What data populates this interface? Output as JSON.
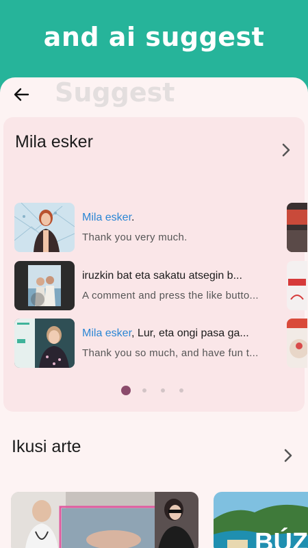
{
  "banner": {
    "title": "and ai suggest"
  },
  "header": {
    "watermark": "Suggest",
    "back_icon": "arrow-left-icon"
  },
  "suggest_card": {
    "title": "Mila esker",
    "chevron_icon": "chevron-right-icon",
    "items": [
      {
        "highlight": "Mila esker",
        "rest": ".",
        "translation": "Thank you very much."
      },
      {
        "highlight": "",
        "rest": "iruzkin bat eta sakatu atsegin b...",
        "translation": "A comment and press the like butto..."
      },
      {
        "highlight": "Mila esker",
        "rest": ", Lur, eta ongi pasa ga...",
        "translation": "Thank you so much, and have fun t..."
      }
    ],
    "pagination": {
      "pages": 4,
      "active": 1
    }
  },
  "section2": {
    "title": "Ikusi arte",
    "chevron_icon": "chevron-right-icon"
  },
  "colors": {
    "accent": "#26b49a",
    "highlight": "#2a86d4",
    "card_bg": "#fae6e8",
    "dot_active": "#8b4a6b"
  }
}
